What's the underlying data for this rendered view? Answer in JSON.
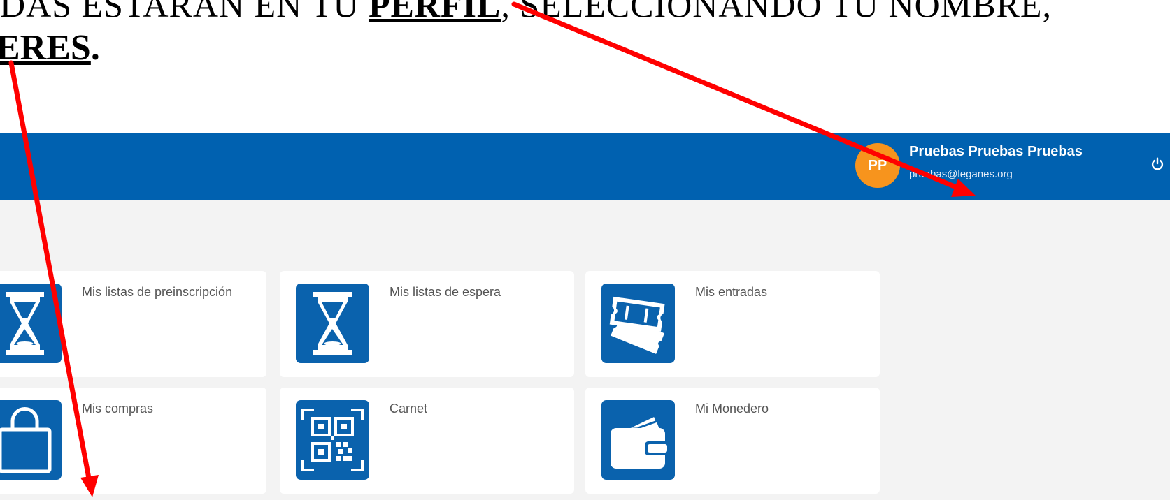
{
  "instruction": {
    "line1_pre": "DAS ESTARÁN EN TU ",
    "line1_link": "PERFIL",
    "line1_post": ", SELECCIONANDO TU NOMBRE,",
    "line2_link": "ERES",
    "line2_post": "."
  },
  "header": {
    "avatar_initials": "PP",
    "user_name": "Pruebas Pruebas Pruebas",
    "user_email": "pruebas@leganes.org",
    "power_icon": "power-icon"
  },
  "tiles": [
    {
      "label": "Mis listas de preinscripción",
      "icon": "hourglass-icon"
    },
    {
      "label": "Mis listas de espera",
      "icon": "hourglass-icon"
    },
    {
      "label": "Mis entradas",
      "icon": "tickets-icon"
    },
    {
      "label": "Mis compras",
      "icon": "shopping-bag-icon"
    },
    {
      "label": "Carnet",
      "icon": "qr-code-icon"
    },
    {
      "label": "Mi Monedero",
      "icon": "wallet-icon"
    }
  ],
  "colors": {
    "header_bg": "#0061b0",
    "icon_bg": "#0a62ad",
    "avatar_bg": "#f7941d",
    "annotation_arrow": "#ff0000"
  }
}
